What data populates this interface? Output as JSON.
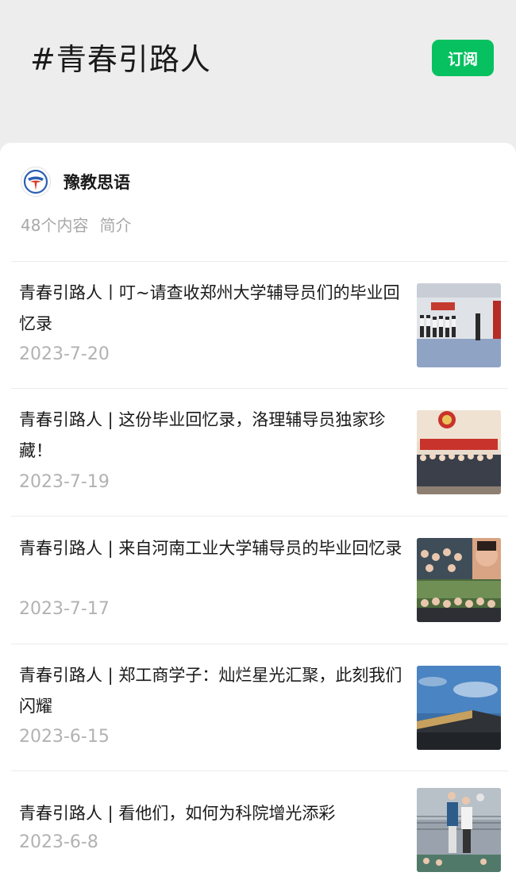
{
  "header": {
    "topic_title": "#青春引路人",
    "subscribe_label": "订阅"
  },
  "account": {
    "name": "豫教思语",
    "avatar_icon": "account-logo-icon",
    "content_count": "48个内容",
    "intro_label": "简介"
  },
  "articles": [
    {
      "title": "青春引路人丨叮~请查收郑州大学辅导员们的毕业回忆录",
      "date": "2023-7-20"
    },
    {
      "title": "青春引路人 | 这份毕业回忆录，洛理辅导员独家珍藏！",
      "date": "2023-7-19"
    },
    {
      "title": "青春引路人 | 来自河南工业大学辅导员的毕业回忆录",
      "date": "2023-7-17"
    },
    {
      "title": "青春引路人 | 郑工商学子：灿烂星光汇聚，此刻我们闪耀",
      "date": "2023-6-15"
    },
    {
      "title": "青春引路人 | 看他们，如何为科院增光添彩",
      "date": "2023-6-8"
    }
  ],
  "colors": {
    "accent": "#07c160",
    "background": "#ededed",
    "text_secondary": "#b2b2b2"
  }
}
